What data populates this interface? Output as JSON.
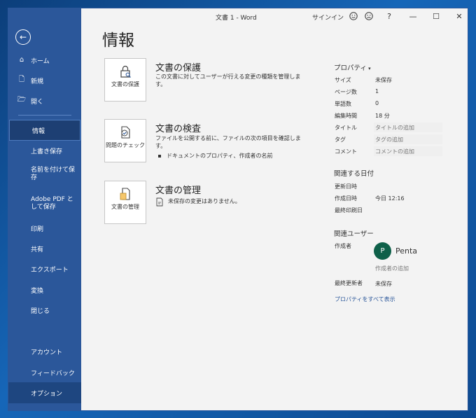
{
  "titlebar": {
    "title": "文書 1  -  Word",
    "signin": "サインイン",
    "smile_icon": "smiley-icon",
    "frown_icon": "frown-icon",
    "help": "?",
    "minimize": "—",
    "maximize": "☐",
    "close": "✕"
  },
  "sidebar": {
    "back_icon": "←",
    "items": [
      {
        "label": "ホーム",
        "icon": "⌂"
      },
      {
        "label": "新規",
        "icon": "🗋"
      },
      {
        "label": "開く",
        "icon": "🗁"
      },
      {
        "label": "情報"
      },
      {
        "label": "上書き保存"
      },
      {
        "label": "名前を付けて保存"
      },
      {
        "label": "Adobe PDF として保存"
      },
      {
        "label": "印刷"
      },
      {
        "label": "共有"
      },
      {
        "label": "エクスポート"
      },
      {
        "label": "変換"
      },
      {
        "label": "閉じる"
      },
      {
        "label": "アカウント"
      },
      {
        "label": "フィードバック"
      },
      {
        "label": "オプション"
      }
    ]
  },
  "main": {
    "page_title": "情報",
    "sections": [
      {
        "tile_label": "文書の保護",
        "tile_icon": "🔒",
        "heading": "文書の保護",
        "description": "この文書に対してユーザーが行える変更の種類を管理します。"
      },
      {
        "tile_label": "問題のチェック",
        "tile_icon": "✔",
        "heading": "文書の検査",
        "description": "ファイルを公開する前に、ファイルの次の項目を確認します。",
        "bullet": "ドキュメントのプロパティ、作成者の名前"
      },
      {
        "tile_label": "文書の管理",
        "tile_icon": "🗎",
        "heading": "文書の管理",
        "description": "未保存の変更はありません。"
      }
    ]
  },
  "properties": {
    "heading": "プロパティ",
    "rows": [
      {
        "label": "サイズ",
        "value": "未保存"
      },
      {
        "label": "ページ数",
        "value": "1"
      },
      {
        "label": "単語数",
        "value": "0"
      },
      {
        "label": "編集時間",
        "value": "18 分"
      },
      {
        "label": "タイトル",
        "value": "タイトルの追加"
      },
      {
        "label": "タグ",
        "value": "タグの追加"
      },
      {
        "label": "コメント",
        "value": "コメントの追加"
      }
    ],
    "dates_heading": "関連する日付",
    "dates": [
      {
        "label": "更新日時",
        "value": ""
      },
      {
        "label": "作成日時",
        "value": "今日 12:16"
      },
      {
        "label": "最終印刷日",
        "value": ""
      }
    ],
    "users_heading": "関連ユーザー",
    "author_label": "作成者",
    "author_initial": "P",
    "author_name": "Penta",
    "add_author": "作成者の追加",
    "last_modified_label": "最終更新者",
    "last_modified_value": "未保存",
    "show_all": "プロパティをすべて表示"
  }
}
